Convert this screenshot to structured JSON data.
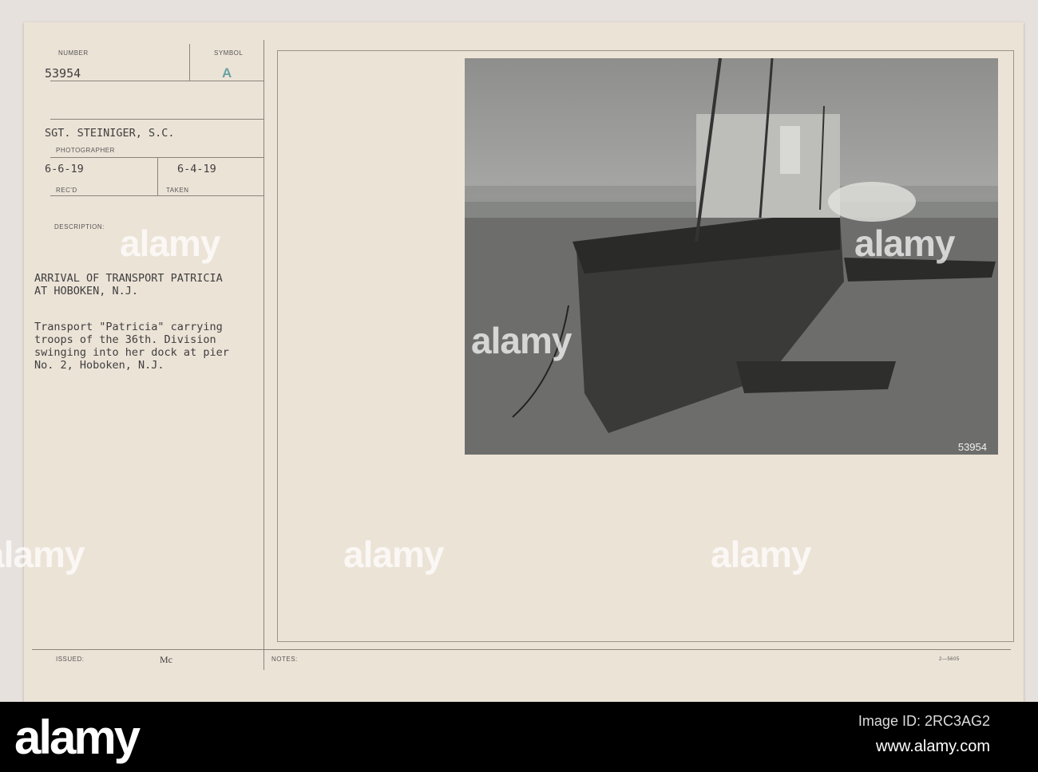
{
  "card": {
    "number_label": "NUMBER",
    "number": "53954",
    "symbol_label": "SYMBOL",
    "symbol": "A",
    "photographer": "SGT. STEINIGER, S.C.",
    "photographer_label": "PHOTOGRAPHER",
    "received": "6-6-19",
    "received_label": "REC'D",
    "taken": "6-4-19",
    "taken_label": "TAKEN",
    "description_label": "DESCRIPTION:",
    "title_lines": [
      "ARRIVAL OF TRANSPORT PATRICIA",
      "AT HOBOKEN, N.J."
    ],
    "caption_lines": [
      "Transport \"Patricia\" carrying",
      "troops of the 36th. Division",
      "swinging into her dock at pier",
      "No. 2, Hoboken, N.J."
    ],
    "issued_label": "ISSUED:",
    "issued": "Mc",
    "notes_label": "NOTES:",
    "form_number": "2—5605",
    "photo_number": "53954"
  },
  "watermark": "alamy",
  "footer": {
    "logo": "alamy",
    "image_id": "Image ID: 2RC3AG2",
    "url": "www.alamy.com"
  }
}
